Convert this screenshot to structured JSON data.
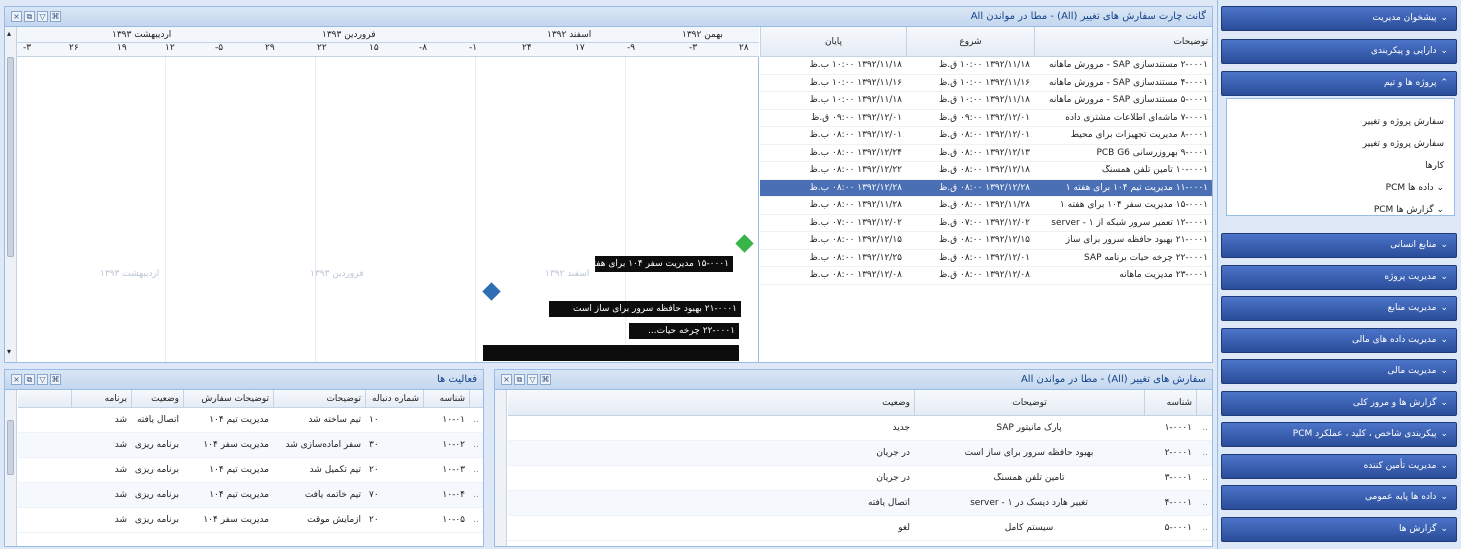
{
  "gantt": {
    "title": "گانت چارت سفارش های تغییر (All) - مطا در مواندن All",
    "columns": {
      "description": "توضیحات",
      "start": "شروع",
      "end": "پایان"
    },
    "months": [
      {
        "label": "اردیبهشت ۱۳۹۳",
        "days": [
          "-۳",
          "۲۶",
          "۱۹",
          "۱۲",
          "-۵",
          "۲۹"
        ]
      },
      {
        "label": "فروردین ۱۳۹۳",
        "days": [
          "۲۲",
          "۱۵",
          "-۸",
          "-۱"
        ]
      },
      {
        "label": "اسفند ۱۳۹۲",
        "days": [
          "۲۴",
          "۱۷",
          "-۹"
        ]
      },
      {
        "label": "بهمن ۱۳۹۲",
        "days": [
          "-۳",
          "۲۸"
        ]
      }
    ],
    "watermarks": [
      "اردیبهشت ۱۳۹۳",
      "فروردین ۱۳۹۳",
      "اسفند ۱۳۹۲"
    ],
    "rows": [
      {
        "desc": "۲-۰۰۰۱ مستندسازی SAP - مرورش ماهانه",
        "start": "۱۳۹۲/۱۱/۱۸ ۱۰:۰۰ ق.ظ",
        "end": "۱۳۹۲/۱۱/۱۸ ۱۰:۰۰ ب.ظ"
      },
      {
        "desc": "۴-۰۰۰۱ مستندسازی SAP - مرورش ماهانه",
        "start": "۱۳۹۲/۱۱/۱۶ ۱۰:۰۰ ق.ظ",
        "end": "۱۳۹۲/۱۱/۱۶ ۱۰:۰۰ ب.ظ"
      },
      {
        "desc": "۵-۰۰۰۱ مستندسازی SAP - مرورش ماهانه",
        "start": "۱۳۹۲/۱۱/۱۸ ۱۰:۰۰ ق.ظ",
        "end": "۱۳۹۲/۱۱/۱۸ ۱۰:۰۰ ب.ظ"
      },
      {
        "desc": "۷-۰۰۰۱ ماشه‌ای اطلاعات مشتری داده",
        "start": "۱۳۹۲/۱۲/۰۱ ۰۹:۰۰ ق.ظ",
        "end": "۱۳۹۲/۱۲/۰۱ ۰۹:۰۰ ق.ظ"
      },
      {
        "desc": "۸-۰۰۰۱ مدیریت تجهیزات برای محیط",
        "start": "۱۳۹۲/۱۲/۰۱ ۰۸:۰۰ ق.ظ",
        "end": "۱۳۹۲/۱۲/۰۱ ۰۸:۰۰ ب.ظ"
      },
      {
        "desc": "۹-۰۰۰۱ بهروزرسانی PCB G6",
        "start": "۱۳۹۲/۱۲/۱۳ ۰۸:۰۰ ق.ظ",
        "end": "۱۳۹۲/۱۲/۲۴ ۰۸:۰۰ ب.ظ"
      },
      {
        "desc": "۱۰-۰۰۰۱ تأمین تلفن همسنگ",
        "start": "۱۳۹۲/۱۲/۱۸ ۰۸:۰۰ ق.ظ",
        "end": "۱۳۹۲/۱۲/۲۲ ۰۸:۰۰ ب.ظ"
      },
      {
        "desc": "۱۱-۰۰۰۱ مدیریت تیم ۱۰۴ برای هفته ۱",
        "start": "۱۳۹۲/۱۲/۲۸ ۰۸:۰۰ ق.ظ",
        "end": "۱۳۹۲/۱۲/۲۸ ۰۸:۰۰ ب.ظ"
      },
      {
        "desc": "۱۵-۰۰۰۱ مدیریت سفر ۱۰۴ برای هفته ۱",
        "start": "۱۳۹۲/۱۱/۲۸ ۰۸:۰۰ ق.ظ",
        "end": "۱۳۹۲/۱۱/۲۸ ۰۸:۰۰ ب.ظ"
      },
      {
        "desc": "۱۲-۰۰۰۱ تعمیر سرور شبکه از ۱ - server",
        "start": "۱۳۹۲/۱۲/۰۲ ۰۷:۰۰ ق.ظ",
        "end": "۱۳۹۲/۱۲/۰۲ ۰۷:۰۰ ب.ظ"
      },
      {
        "desc": "۲۱-۰۰۰۱ بهبود حافظه سرور برای ساز",
        "start": "۱۳۹۲/۱۲/۱۵ ۰۸:۰۰ ق.ظ",
        "end": "۱۳۹۲/۱۲/۱۵ ۰۸:۰۰ ب.ظ"
      },
      {
        "desc": "۲۲-۰۰۰۱ چرخه حیات برنامه SAP",
        "start": "۱۳۹۲/۱۲/۰۱ ۰۸:۰۰ ق.ظ",
        "end": "۱۳۹۲/۱۲/۲۵ ۰۸:۰۰ ب.ظ"
      },
      {
        "desc": "۲۳-۰۰۰۱ مدیریت ماهانه",
        "start": "۱۳۹۲/۱۲/۰۸ ۰۸:۰۰ ق.ظ",
        "end": "۱۳۹۲/۱۲/۰۸ ۰۸:۰۰ ب.ظ"
      }
    ],
    "bars": [
      "۱۵-۰۰۰۱ مدیریت سفر ۱۰۴ برای هفته...",
      "۲۱-۰۰۰۱ بهبود حافظه سرور برای ساز است",
      "۲۲-۰۰۰۱ چرخه حیات..."
    ],
    "milestone_colors": [
      "#39b44a",
      "#2f6db5"
    ]
  },
  "activities": {
    "title": "فعالیت ها",
    "columns": {
      "num": "شناسه",
      "count": "شماره دنباله",
      "desc": "توضیحات",
      "order": "توضیحات سفارش",
      "status": "وضعیت",
      "program": "برنامه"
    },
    "rows": [
      {
        "num": "۱۰-۰۱",
        "count": "۱۰",
        "desc": "تیم ساخته شد",
        "order": "مدیریت تیم ۱۰۴",
        "status": "اتصال یافته",
        "program": "شد"
      },
      {
        "num": "۱۰-۰۲",
        "count": "۳۰",
        "desc": "سفر آماده‌سازی شد",
        "order": "مدیریت سفر ۱۰۴",
        "status": "برنامه ریزی",
        "program": "شد"
      },
      {
        "num": "۱۰-۰۳",
        "count": "۲۰",
        "desc": "تیم تکمیل شد",
        "order": "مدیریت تیم ۱۰۴",
        "status": "برنامه ریزی",
        "program": "شد"
      },
      {
        "num": "۱۰-۰۴",
        "count": "۷۰",
        "desc": "تیم خاتمه یافت",
        "order": "مدیریت تیم ۱۰۴",
        "status": "برنامه ریزی",
        "program": "شد"
      },
      {
        "num": "۱۰-۰۵",
        "count": "۲۰",
        "desc": "آزمایش موقت",
        "order": "مدیریت سفر ۱۰۴",
        "status": "برنامه ریزی",
        "program": "شد"
      }
    ]
  },
  "orders": {
    "title": "سفارش های تغییر (All) - مطا در مواندن All",
    "columns": {
      "num": "شناسه",
      "desc": "توضیحات",
      "status": "وضعیت"
    },
    "rows": [
      {
        "num": "۱-۰۰۰۱",
        "desc": "پارک مانیتور SAP",
        "status": "جدید"
      },
      {
        "num": "۲-۰۰۰۱",
        "desc": "بهبود حافظه سرور برای ساز است",
        "status": "در جریان"
      },
      {
        "num": "۳-۰۰۰۱",
        "desc": "تأمین تلفن همسنگ",
        "status": "در جریان"
      },
      {
        "num": "۴-۰۰۰۱",
        "desc": "تغییر هارد دیسک در ۱ - server",
        "status": "اتصال یافته"
      },
      {
        "num": "۵-۰۰۰۱",
        "desc": "سیستم کامل",
        "status": "لغو"
      }
    ]
  },
  "sidebar": {
    "items_top": [
      "پیشخوان مدیریت",
      "دارایی و پیکربندی",
      "پروژه ها و تیم"
    ],
    "submenu": [
      "سفارش پروژه و تغییر",
      "سفارش پروژه و تغییر",
      "کارها",
      "داده ها PCM",
      "گزارش ها PCM"
    ],
    "items_bottom": [
      "منابع انسانی",
      "مدیریت پروژه",
      "مدیریت منابع",
      "مدیریت داده های مالی",
      "مدیریت مالی",
      "گزارش ها و مرور کلی",
      "پیکربندی شاخص ، کلید ، عملکرد PCM",
      "مدیریت تأمین کننده",
      "داده ها پایه عمومی",
      "گزارش ها"
    ]
  },
  "toolbar_glyphs": {
    "close": "×",
    "restore": "⧉",
    "filter": "▽",
    "pin": "⌘"
  },
  "scroll": {
    "up": "▴",
    "down": "▾"
  }
}
